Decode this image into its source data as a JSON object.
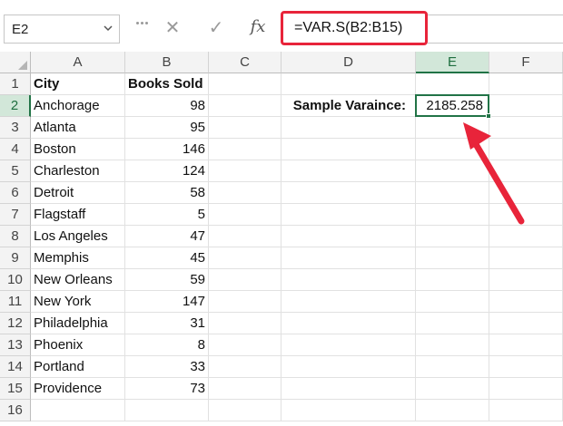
{
  "name_box": {
    "value": "E2"
  },
  "formula_bar": {
    "cancel_glyph": "✕",
    "enter_glyph": "✓",
    "fx_label": "fx",
    "formula": "=VAR.S(B2:B15)"
  },
  "columns": [
    "A",
    "B",
    "C",
    "D",
    "E",
    "F"
  ],
  "rows": [
    "1",
    "2",
    "3",
    "4",
    "5",
    "6",
    "7",
    "8",
    "9",
    "10",
    "11",
    "12",
    "13",
    "14",
    "15",
    "16"
  ],
  "sheet": {
    "header_city": "City",
    "header_books": "Books Sold",
    "data": [
      {
        "city": "Anchorage",
        "books": "98"
      },
      {
        "city": "Atlanta",
        "books": "95"
      },
      {
        "city": "Boston",
        "books": "146"
      },
      {
        "city": "Charleston",
        "books": "124"
      },
      {
        "city": "Detroit",
        "books": "58"
      },
      {
        "city": "Flagstaff",
        "books": "5"
      },
      {
        "city": "Los Angeles",
        "books": "47"
      },
      {
        "city": "Memphis",
        "books": "45"
      },
      {
        "city": "New Orleans",
        "books": "59"
      },
      {
        "city": "New York",
        "books": "147"
      },
      {
        "city": "Philadelphia",
        "books": "31"
      },
      {
        "city": "Phoenix",
        "books": "8"
      },
      {
        "city": "Portland",
        "books": "33"
      },
      {
        "city": "Providence",
        "books": "73"
      }
    ],
    "variance_label": "Sample Varaince:",
    "variance_value": "2185.258"
  },
  "colors": {
    "highlight_red": "#e8243a",
    "excel_green": "#217346"
  }
}
